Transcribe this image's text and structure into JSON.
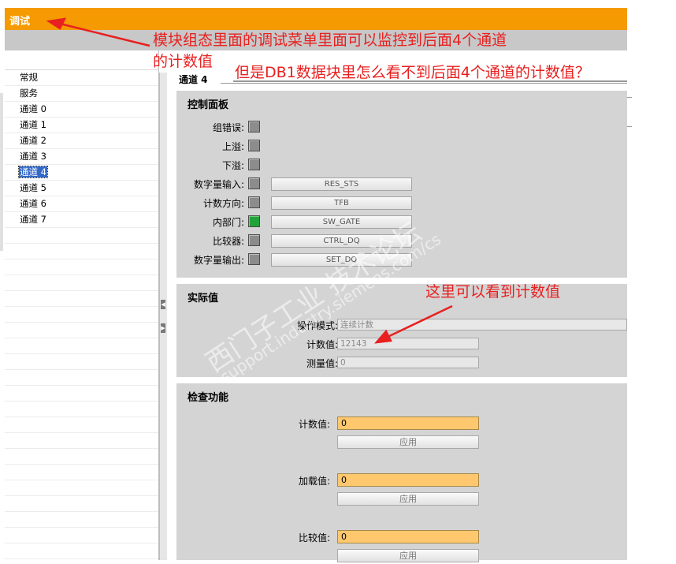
{
  "window": {
    "title": "调试"
  },
  "nav": {
    "items": [
      "常规",
      "服务",
      "通道 0",
      "通道 1",
      "通道 2",
      "通道 3",
      "通道 4",
      "通道 5",
      "通道 6",
      "通道 7"
    ],
    "selected_index": 6
  },
  "content": {
    "channel_title": "通道 4",
    "control_panel": {
      "title": "控制面板",
      "status_rows": [
        {
          "label": "组错误:",
          "on": false
        },
        {
          "label": "上溢:",
          "on": false
        },
        {
          "label": "下溢:",
          "on": false
        },
        {
          "label": "数字量输入:",
          "on": false,
          "button": "RES_STS"
        },
        {
          "label": "计数方向:",
          "on": false,
          "button": "TFB"
        },
        {
          "label": "内部门:",
          "on": true,
          "button": "SW_GATE"
        },
        {
          "label": "比较器:",
          "on": false,
          "button": "CTRL_DQ"
        },
        {
          "label": "数字量输出:",
          "on": false,
          "button": "SET_DQ"
        }
      ]
    },
    "actual_values": {
      "title": "实际值",
      "mode_label": "操作模式:",
      "mode_value": "连续计数",
      "count_label": "计数值:",
      "count_value": "12143",
      "measure_label": "测量值:",
      "measure_value": "0"
    },
    "check_function": {
      "title": "检查功能",
      "groups": [
        {
          "label": "计数值:",
          "value": "0",
          "apply": "应用"
        },
        {
          "label": "加载值:",
          "value": "0",
          "apply": "应用"
        },
        {
          "label": "比较值:",
          "value": "0",
          "apply": "应用"
        }
      ]
    }
  },
  "annotations": {
    "a1_line1": "模块组态里面的调试菜单里面可以监控到后面4个通道",
    "a1_line2": "的计数值",
    "a2": "但是DB1数据块里怎么看不到后面4个通道的计数值？",
    "a3": "这里可以看到计数值"
  },
  "watermark": {
    "line1": "西门子工业 技术论坛",
    "line2": "support.industry.siemens.com/cs"
  },
  "colors": {
    "title_bar": "#f59a00",
    "annotation": "#e82020",
    "input_fill": "#ffc86e",
    "led_on": "#22a33a"
  }
}
